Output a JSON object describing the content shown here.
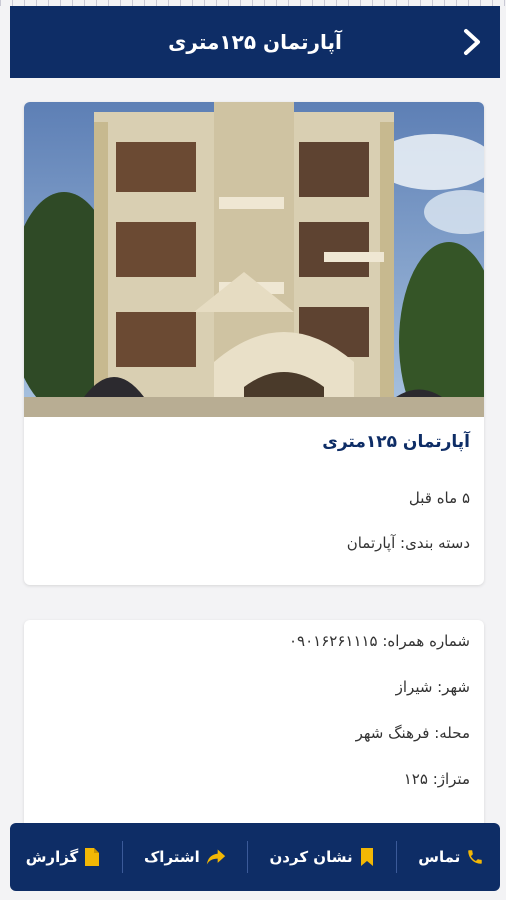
{
  "header": {
    "title": "آپارتمان ۱۲۵متری",
    "back_icon": "chevron-right-icon"
  },
  "ad": {
    "title": "آپارتمان ۱۲۵متری",
    "posted": "۵ ماه قبل",
    "category_line": "دسته بندی: آپارتمان"
  },
  "details": {
    "phone_line": "شماره همراه: ۰۹۰۱۶۲۶۱۱۱۵",
    "city_line": "شهر: شیراز",
    "area_line": "محله: فرهنگ شهر",
    "size_line": "متراژ: ۱۲۵"
  },
  "actions": [
    {
      "label": "تماس",
      "icon": "phone-icon"
    },
    {
      "label": "نشان کردن",
      "icon": "bookmark-icon"
    },
    {
      "label": "اشتراک",
      "icon": "share-icon"
    },
    {
      "label": "گزارش",
      "icon": "document-icon"
    }
  ],
  "colors": {
    "brand": "#0e2d66",
    "accent": "#f2b705",
    "title": "#0e2d66"
  }
}
